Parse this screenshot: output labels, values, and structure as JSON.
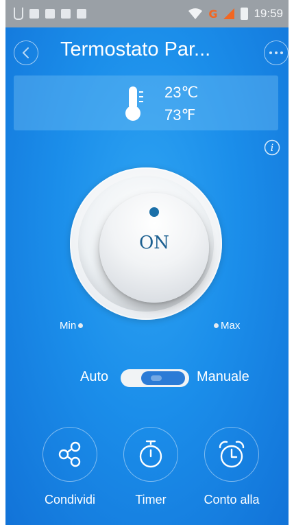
{
  "status_bar": {
    "time": "19:59",
    "network_type": "G"
  },
  "header": {
    "title": "Termostato Par...",
    "back_icon": "chevron-left-icon",
    "more_icon": "more-horizontal-icon"
  },
  "temperature": {
    "celsius": "23℃",
    "fahrenheit": "73℉",
    "icon": "thermometer-icon"
  },
  "info": {
    "icon": "info-icon"
  },
  "knob": {
    "state_label": "ON",
    "min_label": "Min",
    "max_label": "Max"
  },
  "mode": {
    "left_label": "Auto",
    "right_label": "Manuale",
    "selected": "Manuale"
  },
  "actions": [
    {
      "label": "Condividi",
      "icon": "share-icon"
    },
    {
      "label": "Timer",
      "icon": "stopwatch-icon"
    },
    {
      "label": "Conto alla",
      "icon": "alarm-clock-icon"
    }
  ],
  "colors": {
    "background": "#1b8eea",
    "knob_text": "#1b5f90",
    "status_bar": "#9aa0a6",
    "network_accent": "#f26722"
  }
}
